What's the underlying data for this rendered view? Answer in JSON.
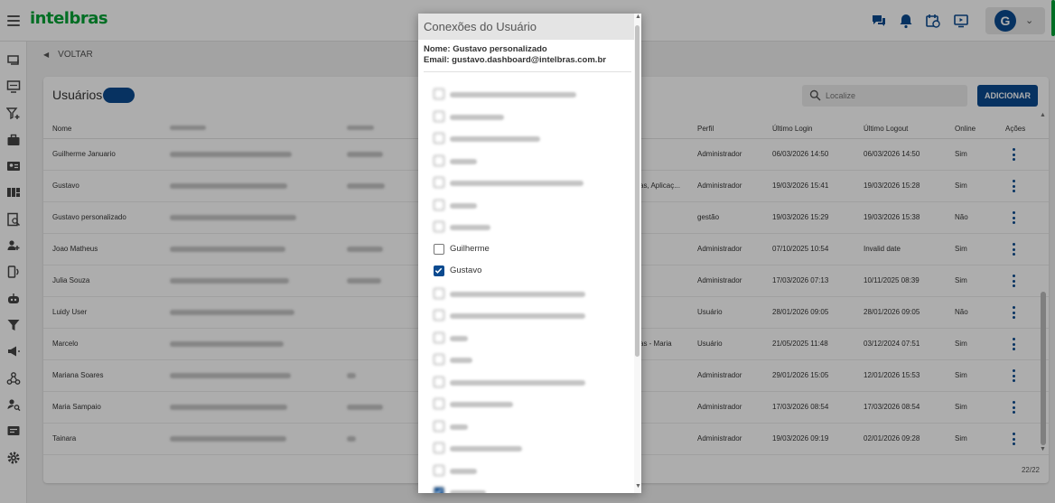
{
  "app": {
    "logo": "intelbras",
    "user_initial": "G"
  },
  "nav": {
    "back_label": "VOLTAR"
  },
  "users_panel": {
    "title": "Usuários",
    "count_badge": "",
    "search_placeholder": "Localize",
    "add_button": "ADICIONAR",
    "columns": [
      "Nome",
      "Perfil",
      "Último Login",
      "Último Logout",
      "Online",
      "Ações"
    ],
    "rows": [
      {
        "name": "Guilherme Januario",
        "extra": "",
        "profile": "Administrador",
        "last_login": "06/03/2026 14:50",
        "last_logout": "06/03/2026 14:50",
        "online": "Sim"
      },
      {
        "name": "Gustavo",
        "extra": "as, Aplicaç...",
        "profile": "Administrador",
        "last_login": "19/03/2026 15:41",
        "last_logout": "19/03/2026 15:28",
        "online": "Sim"
      },
      {
        "name": "Gustavo personalizado",
        "extra": "",
        "profile": "gestão",
        "last_login": "19/03/2026 15:29",
        "last_logout": "19/03/2026 15:38",
        "online": "Não"
      },
      {
        "name": "Joao Matheus",
        "extra": "",
        "profile": "Administrador",
        "last_login": "07/10/2025 10:54",
        "last_logout": "Invalid date",
        "online": "Sim"
      },
      {
        "name": "Julia Souza",
        "extra": "",
        "profile": "Administrador",
        "last_login": "17/03/2026 07:13",
        "last_logout": "10/11/2025 08:39",
        "online": "Sim"
      },
      {
        "name": "Luidy User",
        "extra": "",
        "profile": "Usuário",
        "last_login": "28/01/2026 09:05",
        "last_logout": "28/01/2026 09:05",
        "online": "Não"
      },
      {
        "name": "Marcelo",
        "extra": "as - Maria",
        "profile": "Usuário",
        "last_login": "21/05/2025 11:48",
        "last_logout": "03/12/2024 07:51",
        "online": "Sim"
      },
      {
        "name": "Mariana Soares",
        "extra": "",
        "profile": "Administrador",
        "last_login": "29/01/2026 15:05",
        "last_logout": "12/01/2026 15:53",
        "online": "Sim"
      },
      {
        "name": "Maria Sampaio",
        "extra": "",
        "profile": "Administrador",
        "last_login": "17/03/2026 08:54",
        "last_logout": "17/03/2026 08:54",
        "online": "Sim"
      },
      {
        "name": "Tainara",
        "extra": "",
        "profile": "Administrador",
        "last_login": "19/03/2026 09:19",
        "last_logout": "02/01/2026 09:28",
        "online": "Sim"
      }
    ],
    "pagination": "22/22"
  },
  "modal": {
    "title": "Conexões do Usuário",
    "name_line": "Nome: Gustavo personalizado",
    "email_line": "Email: gustavo.dashboard@intelbras.com.br",
    "connections": [
      {
        "label": "",
        "checked": false,
        "blurred": true
      },
      {
        "label": "",
        "checked": false,
        "blurred": true
      },
      {
        "label": "",
        "checked": false,
        "blurred": true
      },
      {
        "label": "",
        "checked": false,
        "blurred": true
      },
      {
        "label": "",
        "checked": false,
        "blurred": true
      },
      {
        "label": "",
        "checked": false,
        "blurred": true
      },
      {
        "label": "",
        "checked": false,
        "blurred": true
      },
      {
        "label": "Guilherme",
        "checked": false,
        "blurred": false
      },
      {
        "label": "Gustavo",
        "checked": true,
        "blurred": false
      },
      {
        "label": "",
        "checked": false,
        "blurred": true
      },
      {
        "label": "",
        "checked": false,
        "blurred": true
      },
      {
        "label": "",
        "checked": false,
        "blurred": true
      },
      {
        "label": "",
        "checked": false,
        "blurred": true
      },
      {
        "label": "",
        "checked": false,
        "blurred": true
      },
      {
        "label": "",
        "checked": false,
        "blurred": true
      },
      {
        "label": "",
        "checked": false,
        "blurred": true
      },
      {
        "label": "",
        "checked": false,
        "blurred": true
      },
      {
        "label": "",
        "checked": false,
        "blurred": true
      },
      {
        "label": "",
        "checked": true,
        "blurred": true
      }
    ]
  },
  "colors": {
    "brand_green": "#00a335",
    "primary_blue": "#0b4a8f"
  }
}
